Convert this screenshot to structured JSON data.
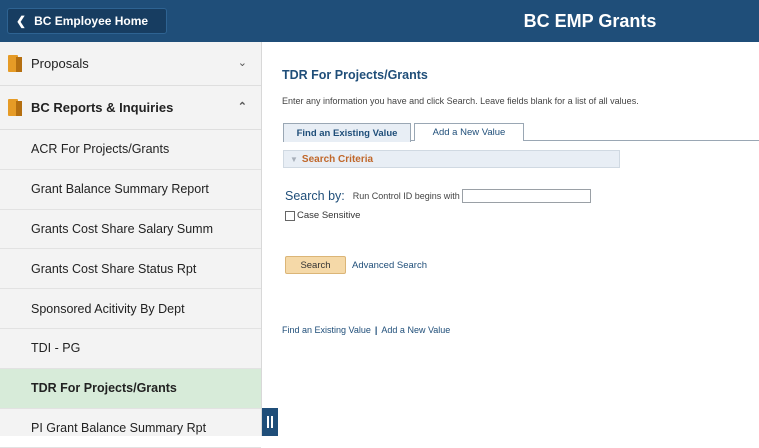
{
  "header": {
    "home_button": "BC Employee Home",
    "app_title": "BC EMP Grants"
  },
  "sidebar": {
    "groups": [
      {
        "label": "Proposals",
        "expanded": false
      },
      {
        "label": "BC Reports & Inquiries",
        "expanded": true
      }
    ],
    "items": [
      {
        "label": "ACR For Projects/Grants"
      },
      {
        "label": "Grant Balance Summary Report"
      },
      {
        "label": "Grants Cost Share Salary Summ"
      },
      {
        "label": "Grants Cost Share Status Rpt"
      },
      {
        "label": "Sponsored Acitivity By Dept"
      },
      {
        "label": "TDI - PG"
      },
      {
        "label": "TDR For Projects/Grants",
        "active": true
      },
      {
        "label": "PI Grant Balance Summary Rpt"
      }
    ]
  },
  "main": {
    "page_title": "TDR For Projects/Grants",
    "instructions": "Enter any information you have and click Search. Leave fields blank for a list of all values.",
    "tabs": [
      {
        "label": "Find an Existing Value",
        "active": true
      },
      {
        "label": "Add a New Value",
        "active": false
      }
    ],
    "search_criteria_label": "Search Criteria",
    "search_by_label": "Search by:",
    "run_control_label": "Run Control ID begins with",
    "run_control_value": "",
    "case_sensitive_label": "Case Sensitive",
    "search_button": "Search",
    "advanced_search": "Advanced Search",
    "bottom_links": {
      "find": "Find an Existing Value",
      "separator": "|",
      "add": "Add a New Value"
    }
  },
  "colors": {
    "header_bg": "#1f4e79",
    "active_item_bg": "#d7ebd9",
    "folder_icon": "#e69b26",
    "search_button_bg": "#f5d9a8",
    "criteria_text": "#c0672a"
  }
}
